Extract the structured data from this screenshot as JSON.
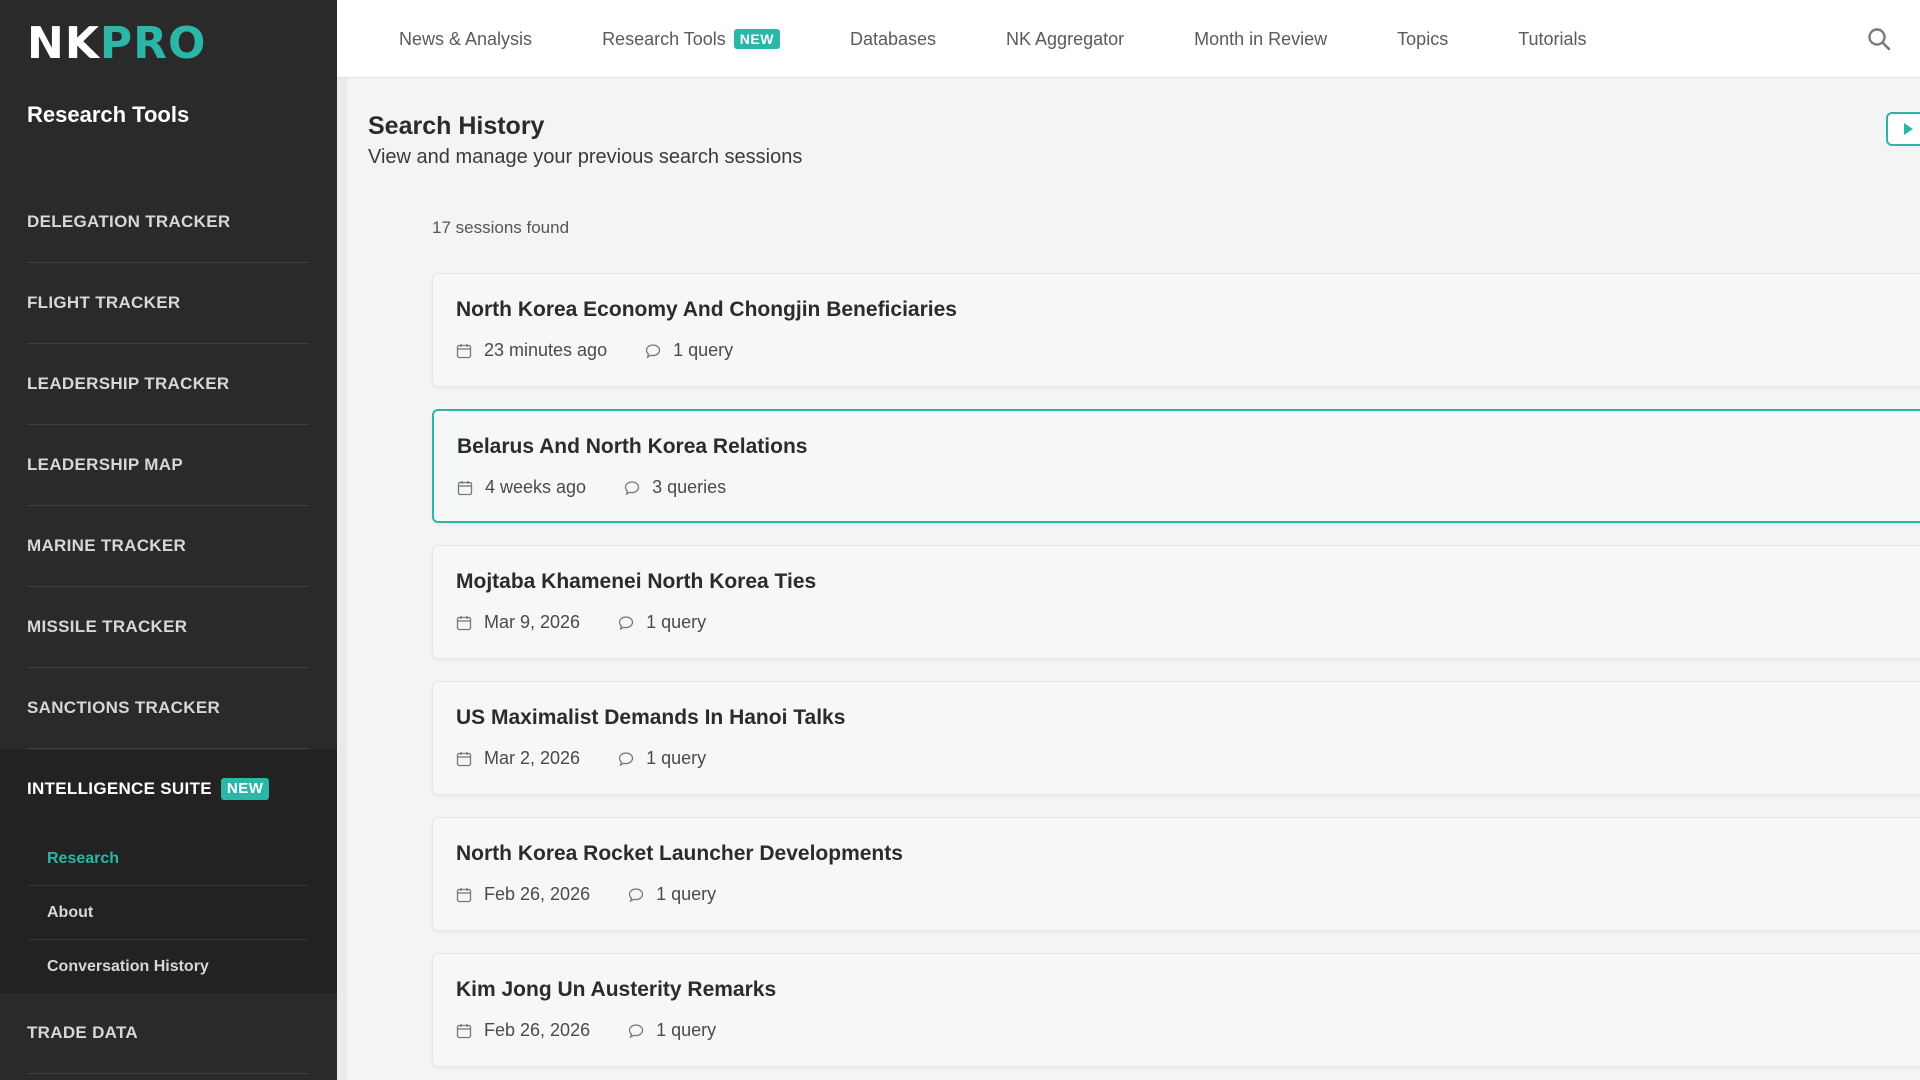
{
  "sidebar": {
    "logo_nk": "NK",
    "logo_pro": "PRO",
    "title": "Research Tools",
    "items": [
      {
        "label": "DELEGATION TRACKER"
      },
      {
        "label": "FLIGHT TRACKER"
      },
      {
        "label": "LEADERSHIP TRACKER"
      },
      {
        "label": "LEADERSHIP MAP"
      },
      {
        "label": "MARINE TRACKER"
      },
      {
        "label": "MISSILE TRACKER"
      },
      {
        "label": "SANCTIONS TRACKER"
      }
    ],
    "intel": {
      "label": "INTELLIGENCE SUITE",
      "badge": "NEW",
      "sub_items": [
        {
          "label": "Research",
          "active": true
        },
        {
          "label": "About"
        },
        {
          "label": "Conversation History"
        }
      ]
    },
    "trade": "TRADE DATA"
  },
  "topnav": {
    "items": [
      {
        "label": "News & Analysis"
      },
      {
        "label": "Research Tools",
        "badge": "NEW"
      },
      {
        "label": "Databases"
      },
      {
        "label": "NK Aggregator"
      },
      {
        "label": "Month in Review"
      },
      {
        "label": "Topics"
      },
      {
        "label": "Tutorials"
      }
    ],
    "search_icon": "search-icon"
  },
  "main": {
    "title": "Search History",
    "subtitle": "View and manage your previous search sessions",
    "count": "17 sessions found",
    "sessions": [
      {
        "title": "North Korea Economy And Chongjin Beneficiaries",
        "date": "23 minutes ago",
        "queries": "1 query"
      },
      {
        "title": "Belarus And North Korea Relations",
        "date": "4 weeks ago",
        "queries": "3 queries",
        "selected": true
      },
      {
        "title": "Mojtaba Khamenei North Korea Ties",
        "date": "Mar 9, 2026",
        "queries": "1 query"
      },
      {
        "title": "US Maximalist Demands In Hanoi Talks",
        "date": "Mar 2, 2026",
        "queries": "1 query"
      },
      {
        "title": "North Korea Rocket Launcher Developments",
        "date": "Feb 26, 2026",
        "queries": "1 query"
      },
      {
        "title": "Kim Jong Un Austerity Remarks",
        "date": "Feb 26, 2026",
        "queries": "1 query"
      }
    ]
  },
  "colors": {
    "accent": "#2bb6a8",
    "sidebar_bg": "#2a2a2a",
    "page_bg": "#f3f5f4"
  }
}
